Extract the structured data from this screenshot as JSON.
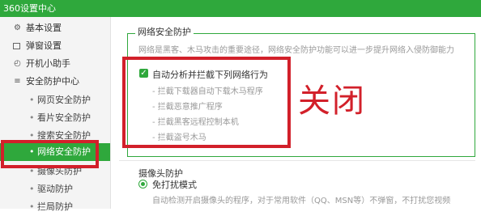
{
  "window": {
    "title": "360设置中心"
  },
  "sidebar": {
    "items": [
      {
        "label": "基本设置",
        "icon": "gear-icon"
      },
      {
        "label": "弹窗设置",
        "icon": "window-icon"
      },
      {
        "label": "开机小助手",
        "icon": "clock-icon"
      },
      {
        "label": "安全防护中心",
        "icon": "shield-list-icon"
      }
    ],
    "sub_items": [
      {
        "label": "网页安全防护"
      },
      {
        "label": "看片安全防护"
      },
      {
        "label": "搜索安全防护"
      },
      {
        "label": "网络安全防护",
        "active": true
      },
      {
        "label": "摄像头防护"
      },
      {
        "label": "驱动防护"
      },
      {
        "label": "拦局防护"
      }
    ]
  },
  "network_section": {
    "legend": "网络安全防护",
    "description": "网络是黑客、木马攻击的重要途径，网络安全防护功能可以进一步提升网络入侵防御能力",
    "checkbox_label": "自动分析并拦截下列网络行为",
    "checked": true,
    "options": [
      "- 拦截下载器自动下载木马程序",
      "- 拦截恶意推广程序",
      "- 拦截黑客远程控制本机",
      "- 拦截盗号木马"
    ]
  },
  "annotation": {
    "text": "关闭",
    "color": "#d2202a"
  },
  "camera_section": {
    "legend": "摄像头防护",
    "radio_label": "免打扰模式",
    "description": "自动检测开启摄像头的程序，对于常用软件（QQ、MSN等）不弹窗，不打扰您视频"
  },
  "colors": {
    "accent": "#2fa83c",
    "highlight": "#d2202a"
  }
}
